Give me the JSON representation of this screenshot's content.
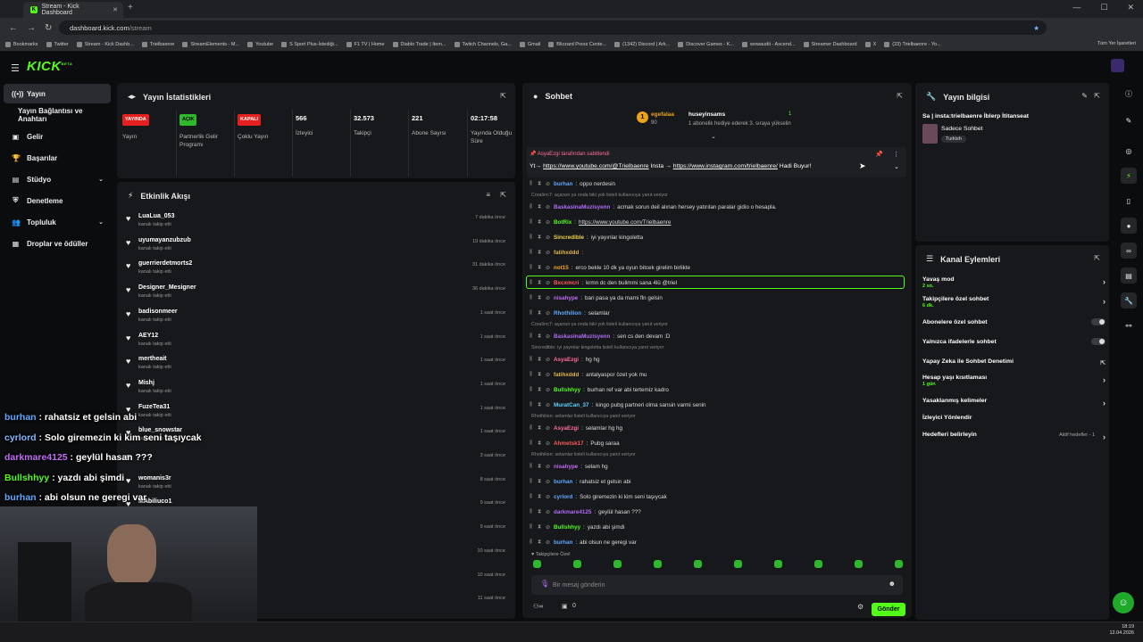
{
  "browser": {
    "tab_title": "Stream - Kick Dashboard",
    "url_host": "dashboard.kick.com",
    "url_path": "/stream",
    "bookmarks": [
      "Bookmarks",
      "Twitter",
      "Stream - Kick Dashb...",
      "Trielbaenre",
      "StreamElements - M...",
      "Youtube",
      "S Sport Plus-İstediği...",
      "F1 TV | Home",
      "Diablo Trade | Item...",
      "Twitch Channels, Ga...",
      "Gmail",
      "Blizzard Press Cente...",
      "(1342) Discord | Ark...",
      "Discover Games - K...",
      "wowaudit - Ascend...",
      "Streamer Dashboard",
      "X",
      "(23) Trielbaenre - Yo..."
    ],
    "bookmarks_right": "Tüm Yer İşaretleri"
  },
  "sidebar": {
    "items": [
      {
        "label": "Yayın",
        "icon": "broadcast-icon"
      },
      {
        "label": "Yayın Bağlantısı ve Anahtarı",
        "icon": ""
      },
      {
        "label": "Gelir",
        "icon": "income-icon"
      },
      {
        "label": "Başarılar",
        "icon": "trophy-icon"
      },
      {
        "label": "Stüdyo",
        "icon": "studio-icon"
      },
      {
        "label": "Denetleme",
        "icon": "moderation-icon"
      },
      {
        "label": "Topluluk",
        "icon": "community-icon"
      },
      {
        "label": "Droplar ve ödüller",
        "icon": "drops-icon"
      }
    ]
  },
  "stats": {
    "title": "Yayın İstatistikleri",
    "items": [
      {
        "badge": "YAYINDA",
        "label": "Yayın"
      },
      {
        "badge": "AÇIK",
        "label": "Partnerlik Gelir Programı"
      },
      {
        "badge": "KAPALI",
        "label": "Çoklu Yayın"
      },
      {
        "value": "566",
        "label": "İzleyici"
      },
      {
        "value": "32.573",
        "label": "Takipçi"
      },
      {
        "value": "221",
        "label": "Abone Sayısı"
      },
      {
        "value": "02:17:58",
        "label": "Yayında Olduğu Süre"
      }
    ]
  },
  "activity": {
    "title": "Etkinlik Akışı",
    "events": [
      {
        "name": "LuaLua_053",
        "desc": "kanalı takip etti",
        "time": "7 dakika önce"
      },
      {
        "name": "uyumayanzubzub",
        "desc": "kanalı takip etti",
        "time": "19 dakika önce"
      },
      {
        "name": "guerrierdetmorts2",
        "desc": "kanalı takip etti",
        "time": "31 dakika önce"
      },
      {
        "name": "Designer_Mesigner",
        "desc": "kanalı takip etti",
        "time": "36 dakika önce"
      },
      {
        "name": "badisonmeer",
        "desc": "kanalı takip etti",
        "time": "1 saat önce"
      },
      {
        "name": "AEY12",
        "desc": "kanalı takip etti",
        "time": "1 saat önce"
      },
      {
        "name": "mertheait",
        "desc": "kanalı takip etti",
        "time": "1 saat önce"
      },
      {
        "name": "Mishj",
        "desc": "kanalı takip etti",
        "time": "1 saat önce"
      },
      {
        "name": "FuzeTea31",
        "desc": "kanalı takip etti",
        "time": "1 saat önce"
      },
      {
        "name": "blue_snowstar",
        "desc": "kanalı takip etti",
        "time": "1 saat önce"
      },
      {
        "name": "",
        "desc": "",
        "time": "3 saat önce"
      },
      {
        "name": "womanis3r",
        "desc": "kanalı takip etti",
        "time": "8 saat önce"
      },
      {
        "name": "MAbiliuco1",
        "desc": "",
        "time": "9 saat önce"
      },
      {
        "name": "",
        "desc": "",
        "time": "9 saat önce"
      },
      {
        "name": "",
        "desc": "",
        "time": "10 saat önce"
      },
      {
        "name": "",
        "desc": "",
        "time": "10 saat önce"
      },
      {
        "name": "",
        "desc": "",
        "time": "11 saat önce"
      }
    ]
  },
  "chat": {
    "title": "Sohbet",
    "gift_leader": {
      "user": "egefalaa",
      "count": "90",
      "rank": "1"
    },
    "gift_second": {
      "user": "huseyinsams",
      "count": "1"
    },
    "gift_text": "1 abonelik hediye ederek 3. sıraya yükselin",
    "pinned_by": "AsyaEzgi tarafından sabitlendi",
    "pinned_msg_a": "Yt→ ",
    "pinned_link1": "https://www.youtube.com/@Trielbaenre",
    "pinned_msg_b": " Insta → ",
    "pinned_link2": "https://www.instagram.com/trielbaenre/",
    "pinned_msg_c": " Hadi Buyur!",
    "messages": [
      {
        "user": "burhan",
        "color": "#5fa8ff",
        "text": "oppo nerdesin"
      },
      {
        "reply": "Coralirrc7: açarsın ya onda biki yok listeli kullanıcıya yanıt veriyor"
      },
      {
        "user": "BaskasinaMuzisyenn",
        "color": "#b06cf5",
        "text": "acmak sorun deil alınan hersey yatırılan paralar gidio o hesapla."
      },
      {
        "user": "BotRix",
        "color": "#53fc18",
        "text": "https://www.youtube.com/Trielbaenre"
      },
      {
        "user": "Sincredible",
        "color": "#f2d24a",
        "text": "iyi yayınlar kingoletta"
      },
      {
        "user": "fatihxddd",
        "color": "#e3b341",
        "text": ""
      },
      {
        "user": "not15",
        "color": "#f5a623",
        "text": "erco bekle 10 dk ya oyun bitcek girelim birlikte"
      },
      {
        "user": "Bxcxmcri",
        "color": "#ff5a5a",
        "text": "krmn dc den bulimmi sana 4lü @triel"
      },
      {
        "user": "nisahype",
        "color": "#c06cf5",
        "text": "bari pasa ya da mami fln gelsin"
      },
      {
        "user": "Rhothilion",
        "color": "#5fa8ff",
        "text": "selamlar"
      },
      {
        "reply": "Coralirrc7: açarsın ya onda biki yok listeli kullanıcıya yanıt veriyor"
      },
      {
        "user": "BaskasinaMuzisyenn",
        "color": "#b06cf5",
        "text": "sen cs den devam :D"
      },
      {
        "reply": "Sincredible: iyi yayınlar kingoletta listeli kullanıcıya yanıt veriyor"
      },
      {
        "user": "AsyaEzgi",
        "color": "#ff6b9a",
        "text": "hg hg"
      },
      {
        "user": "fatihxddd",
        "color": "#e3b341",
        "text": "antalyaspor özet yok mu"
      },
      {
        "user": "Bullshhyy",
        "color": "#53fc18",
        "text": "burhan ref var abi tertemiz kadro"
      },
      {
        "user": "MuratCan_37",
        "color": "#5fd0ff",
        "text": "kingo pubg partneri olma sansin varmi senin"
      },
      {
        "reply": "Rhothilion: selamlar listeli kullanıcıya yanıt veriyor"
      },
      {
        "user": "AsyaEzgi",
        "color": "#ff6b9a",
        "text": "selamlar hg hg"
      },
      {
        "user": "Ahmetsk17",
        "color": "#ff5a5a",
        "text": "Pubg saraa"
      },
      {
        "reply": "Rhothilion: selamlar listeli kullanıcıya yanıt veriyor"
      },
      {
        "user": "nisahype",
        "color": "#c06cf5",
        "text": "selam hg"
      },
      {
        "user": "burhan",
        "color": "#5fa8ff",
        "text": "rahatsiz et gelsin abi"
      },
      {
        "user": "cyrlord",
        "color": "#5fa8ff",
        "text": "Solo giremezin ki kim seni taşıycak"
      },
      {
        "user": "darkmare4125",
        "color": "#b06cf5",
        "text": "geylül hasan ???"
      },
      {
        "user": "Bullshhyy",
        "color": "#53fc18",
        "text": "yazdı abi şimdi"
      },
      {
        "user": "burhan",
        "color": "#5fa8ff",
        "text": "abi olsun ne geregi var"
      }
    ],
    "followers_only": "Takipçilere Özel",
    "input_placeholder": "Bir mesaj gönderin",
    "zero": "0",
    "send": "Gönder"
  },
  "streaminfo": {
    "title": "Yayın bilgisi",
    "stream_title": "Sa | insta:trielbaenre İblerp İtitanseat",
    "chat_mode": "Sadece Sohbet",
    "language": "Turkish"
  },
  "actions": {
    "title": "Kanal Eylemleri",
    "items": [
      {
        "label": "Yavaş mod",
        "sub": "2 sn.",
        "kind": "chev"
      },
      {
        "label": "Takipçilere özel sohbet",
        "sub": "6 dk.",
        "kind": "chev"
      },
      {
        "label": "Abonelere özel sohbet",
        "sub": "",
        "kind": "toggle"
      },
      {
        "label": "Yalnızca ifadelerle sohbet",
        "sub": "",
        "kind": "toggle"
      },
      {
        "label": "Yapay Zeka ile Sohbet Denetimi",
        "sub": "",
        "kind": "ext"
      },
      {
        "label": "Hesap yaşı kısıtlaması",
        "sub": "1 gün",
        "kind": "chev"
      },
      {
        "label": "Yasaklanmış kelimeler",
        "sub": "",
        "kind": "chev"
      },
      {
        "label": "İzleyici Yönlendir",
        "sub": "",
        "kind": "none"
      },
      {
        "label": "Hedefleri belirleyin",
        "sub": "",
        "kind": "goal",
        "extra": "Aktif hedefler - 1"
      }
    ]
  },
  "overlay": {
    "lines": [
      {
        "user": "burhan",
        "color": "#5fa8ff",
        "text": " : rahatsiz et gelsin abi"
      },
      {
        "user": "cyrlord",
        "color": "#7fb8ff",
        "text": " : Solo giremezin ki kim seni taşıycak"
      },
      {
        "user": "darkmare4125",
        "color": "#c06cf5",
        "text": " : geylül hasan ???"
      },
      {
        "user": "Bullshhyy",
        "color": "#53fc18",
        "text": " : yazdı abi şimdi"
      },
      {
        "user": "burhan",
        "color": "#5fa8ff",
        "text": " : abi olsun ne geregi var"
      }
    ]
  },
  "clock": {
    "time": "18:19",
    "date": "12.04.2026"
  },
  "colors": {
    "accent": "#53fc18",
    "panel": "#17181b",
    "bg": "#0b0c0e"
  }
}
